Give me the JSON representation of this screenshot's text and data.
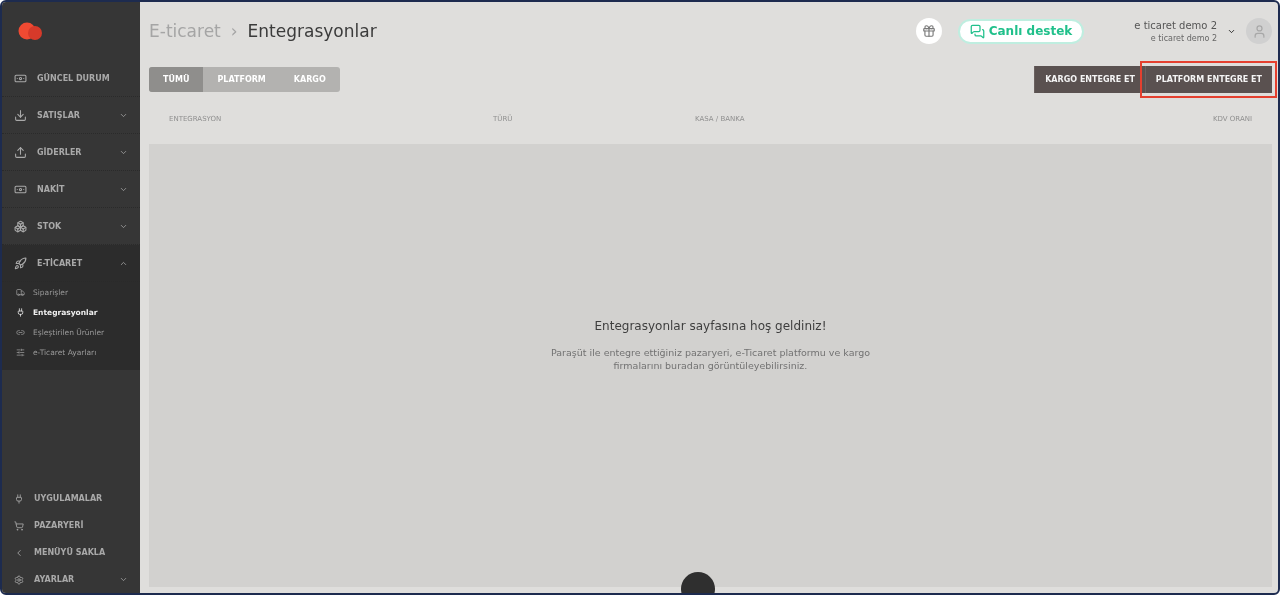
{
  "sidebar": {
    "items": [
      {
        "label": "GÜNCEL DURUM",
        "kind": "link"
      },
      {
        "label": "SATIŞLAR",
        "kind": "group",
        "expanded": false
      },
      {
        "label": "GİDERLER",
        "kind": "group",
        "expanded": false
      },
      {
        "label": "NAKİT",
        "kind": "group",
        "expanded": false
      },
      {
        "label": "STOK",
        "kind": "group",
        "expanded": false
      },
      {
        "label": "E-TİCARET",
        "kind": "group",
        "expanded": true,
        "children": [
          {
            "label": "Siparişler",
            "selected": false
          },
          {
            "label": "Entegrasyonlar",
            "selected": true
          },
          {
            "label": "Eşleştirilen Ürünler",
            "selected": false
          },
          {
            "label": "e-Ticaret Ayarları",
            "selected": false
          }
        ]
      }
    ],
    "bottom_items": [
      {
        "label": "UYGULAMALAR",
        "kind": "link"
      },
      {
        "label": "PAZARYERİ",
        "kind": "link"
      },
      {
        "label": "MENÜYÜ SAKLA",
        "kind": "link"
      },
      {
        "label": "AYARLAR",
        "kind": "group",
        "expanded": false
      }
    ]
  },
  "breadcrumb": {
    "parent": "E-ticaret",
    "separator": "›",
    "current": "Entegrasyonlar"
  },
  "support_button": "Canlı destek",
  "user": {
    "name": "e ticaret demo 2",
    "company": "e ticaret demo 2"
  },
  "tabs": [
    {
      "label": "TÜMÜ",
      "selected": true
    },
    {
      "label": "PLATFORM",
      "selected": false
    },
    {
      "label": "KARGO",
      "selected": false
    }
  ],
  "actions": [
    {
      "label": "KARGO ENTEGRE ET",
      "highlighted": false
    },
    {
      "label": "PLATFORM ENTEGRE ET",
      "highlighted": true
    }
  ],
  "table": {
    "columns": [
      "ENTEGRASYON",
      "TÜRÜ",
      "KASA / BANKA",
      "KDV ORANI"
    ]
  },
  "empty_state": {
    "title": "Entegrasyonlar sayfasına hoş geldiniz!",
    "message": "Paraşüt ile entegre ettiğiniz pazaryeri, e-Ticaret platformu ve kargo firmalarını buradan görüntüleyebilirsiniz."
  }
}
